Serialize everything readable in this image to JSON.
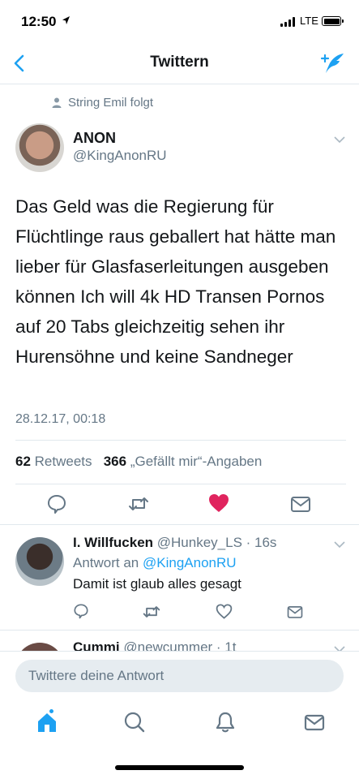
{
  "status": {
    "time": "12:50",
    "network": "LTE",
    "battery_level": 1.0
  },
  "nav": {
    "title": "Twittern"
  },
  "social_context": {
    "text": "String Emil folgt"
  },
  "tweet": {
    "author_name": "ANON",
    "author_handle": "@KingAnonRU",
    "text": "Das Geld was die Regierung für Flüchtlinge raus geballert hat hätte man lieber für Glasfaserleitungen ausgeben können Ich will 4k HD Transen Pornos auf 20 Tabs gleichzeitig sehen ihr Hurensöhne und keine Sandneger",
    "timestamp": "28.12.17, 00:18",
    "retweet_count": "62",
    "retweet_label": "Retweets",
    "like_count": "366",
    "like_label": "„Gefällt mir“-Angaben"
  },
  "reply": {
    "name": "I. Willfucken",
    "handle_time": "@Hunkey_LS · 16s",
    "reply_prefix": "Antwort an",
    "reply_to": "@KingAnonRU",
    "text": "Damit ist glaub alles gesagt"
  },
  "next_reply": {
    "name": "Cummi",
    "handle_time": "@newcummer · 1t"
  },
  "reply_box": {
    "placeholder": "Twittere deine Antwort"
  },
  "colors": {
    "accent": "#1da1f2",
    "like": "#e0245e",
    "muted": "#657786",
    "text": "#14171a"
  },
  "icons": [
    "back-icon",
    "compose-icon",
    "person-icon",
    "chevron-down-icon",
    "reply-icon",
    "retweet-icon",
    "heart-icon",
    "dm-icon",
    "home-icon",
    "search-icon",
    "bell-icon",
    "mail-icon"
  ]
}
